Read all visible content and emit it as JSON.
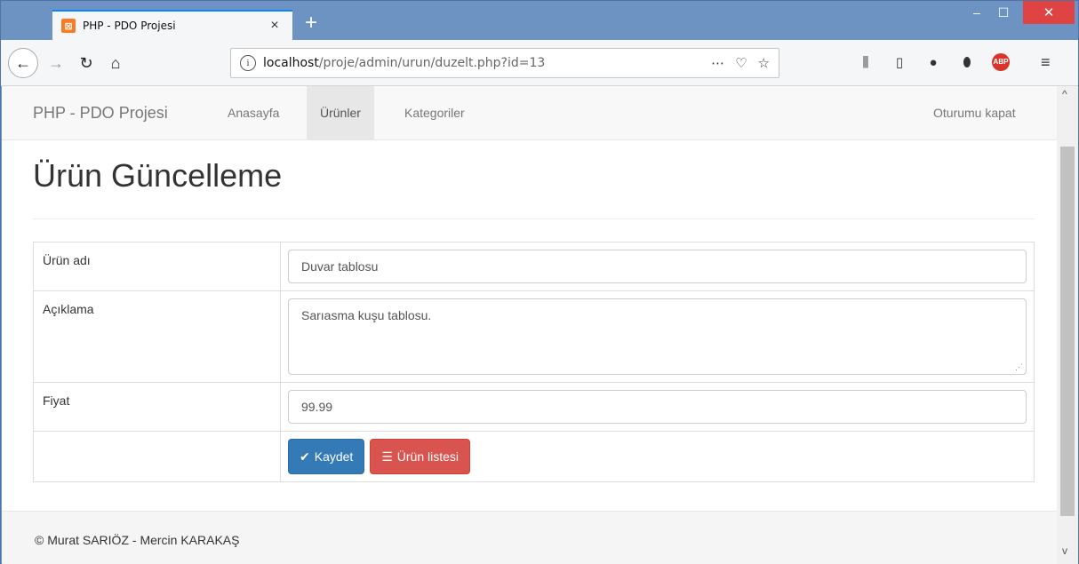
{
  "browser": {
    "tab_title": "PHP - PDO Projesi",
    "tab_close": "×",
    "new_tab": "+",
    "url_host": "localhost",
    "url_path": "/proje/admin/urun/duzelt.php?id=13",
    "win_min": "–",
    "win_max": "☐",
    "win_close": "✕"
  },
  "site": {
    "brand": "PHP - PDO Projesi",
    "nav": [
      "Anasayfa",
      "Ürünler",
      "Kategoriler"
    ],
    "logout": "Oturumu kapat"
  },
  "page": {
    "heading": "Ürün Güncelleme"
  },
  "form": {
    "name_label": "Ürün adı",
    "name_value": "Duvar tablosu",
    "desc_label": "Açıklama",
    "desc_value": "Sarıasma kuşu tablosu.",
    "price_label": "Fiyat",
    "price_value": "99.99",
    "save_label": "Kaydet",
    "list_label": "Ürün listesi"
  },
  "footer": {
    "text": "© Murat SARIÖZ - Mercin KARAKAŞ"
  }
}
